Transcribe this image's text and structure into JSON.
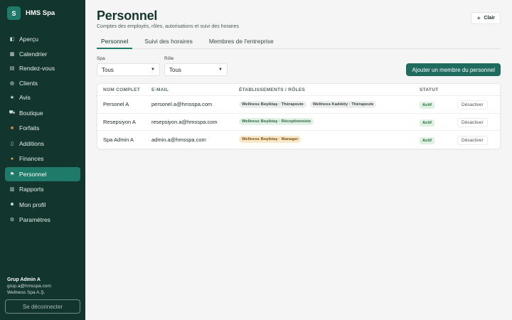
{
  "brand": {
    "logo_letter": "S",
    "name": "HMS Spa"
  },
  "sidebar": {
    "items": [
      {
        "label": "Aperçu",
        "icon": "overview-icon"
      },
      {
        "label": "Calendrier",
        "icon": "calendar-icon"
      },
      {
        "label": "Rendez-vous",
        "icon": "appointments-icon"
      },
      {
        "label": "Clients",
        "icon": "clients-icon"
      },
      {
        "label": "Avis",
        "icon": "star-icon"
      },
      {
        "label": "Boutique",
        "icon": "cart-icon"
      },
      {
        "label": "Forfaits",
        "icon": "package-icon"
      },
      {
        "label": "Additions",
        "icon": "receipt-icon"
      },
      {
        "label": "Finances",
        "icon": "money-bag-icon"
      },
      {
        "label": "Personnel",
        "icon": "flag-icon"
      },
      {
        "label": "Rapports",
        "icon": "chart-icon"
      },
      {
        "label": "Mon profil",
        "icon": "user-icon"
      },
      {
        "label": "Paramètres",
        "icon": "gear-icon"
      }
    ],
    "active_index": 9,
    "user": {
      "name": "Grup Admin A",
      "email": "grup.a@hmsspa.com",
      "company": "Wellness Spa A.Ş."
    },
    "logout_label": "Se déconnecter"
  },
  "header": {
    "title": "Personnel",
    "subtitle": "Comptes des employés, rôles, autorisations et suivi des horaires",
    "theme_label": "Clair"
  },
  "tabs": [
    "Personnel",
    "Suivi des horaires",
    "Membres de l'entreprise"
  ],
  "filters": {
    "spa_label": "Spa",
    "spa_value": "Tous",
    "role_label": "Rôle",
    "role_value": "Tous"
  },
  "add_button": "Ajouter un membre du personnel",
  "table": {
    "headers": [
      "NOM COMPLET",
      "E-MAIL",
      "ÉTABLISSEMENTS / RÔLES",
      "STATUT",
      ""
    ],
    "rows": [
      {
        "name": "Personel A",
        "email": "personel.a@hmsspa.com",
        "tags": [
          "Wellness Beşiktaş · Thérapeute",
          "Wellness Kadıköy · Thérapeute"
        ],
        "status": "Actif",
        "action": "Désactiver"
      },
      {
        "name": "Resepsiyon A",
        "email": "resepsiyon.a@hmsspa.com",
        "tags": [
          "Wellness Beşiktaş · Réceptionniste"
        ],
        "status": "Actif",
        "action": "Désactiver"
      },
      {
        "name": "Spa Admin A",
        "email": "admin.a@hmsspa.com",
        "tags": [
          "Wellness Beşiktaş · Manager"
        ],
        "status": "Actif",
        "action": "Désactiver"
      }
    ]
  },
  "colors": {
    "sidebar_bg": "#12352d",
    "accent": "#1f7a6a",
    "primary_button": "#1f6b5e"
  }
}
